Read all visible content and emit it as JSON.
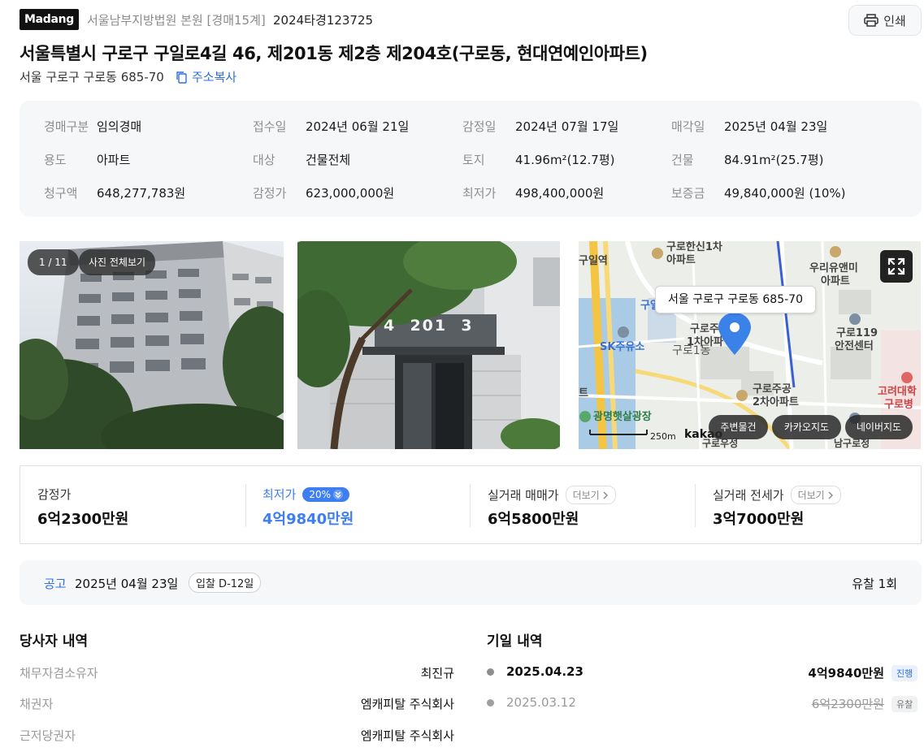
{
  "header": {
    "logo": "Madang",
    "court": "서울남부지방법원 본원 [경매15계]",
    "case_number": "2024타경123725",
    "print_label": "인쇄",
    "title": "서울특별시 구로구 구일로4길 46, 제201동 제2층 제204호(구로동, 현대연예인아파트)",
    "lot_address": "서울 구로구 구로동 685-70",
    "copy_label": "주소복사"
  },
  "info": {
    "rows": [
      [
        {
          "label": "경매구분",
          "value": "임의경매"
        },
        {
          "label": "접수일",
          "value": "2024년 06월 21일"
        },
        {
          "label": "감정일",
          "value": "2024년 07월 17일"
        },
        {
          "label": "매각일",
          "value": "2025년 04월 23일"
        }
      ],
      [
        {
          "label": "용도",
          "value": "아파트"
        },
        {
          "label": "대상",
          "value": "건물전체"
        },
        {
          "label": "토지",
          "value": "41.96m²(12.7평)"
        },
        {
          "label": "건물",
          "value": "84.91m²(25.7평)"
        }
      ],
      [
        {
          "label": "청구액",
          "value": "648,277,783원"
        },
        {
          "label": "감정가",
          "value": "623,000,000원"
        },
        {
          "label": "최저가",
          "value": "498,400,000원"
        },
        {
          "label": "보증금",
          "value": "49,840,000원 (10%)"
        }
      ]
    ]
  },
  "photos": {
    "counter": "1 / 11",
    "view_all": "사진 전체보기",
    "building_number_text": "4  201  3"
  },
  "map": {
    "tooltip": "서울 구로구 구로동 685-70",
    "labels": {
      "guro_hanshin_1": "구로한신1차",
      "apart1": "아파트",
      "guil_station": "구일역",
      "uri_1": "우리유앤미",
      "apart2": "아파트",
      "gu_short": "구일",
      "guro_ju_1": "구로주",
      "cha_1": "1차아파",
      "guro_1dong": "구로1동",
      "sk": "SK주유소",
      "safety_1": "구로119",
      "safety_2": "안전센터",
      "guro_jugong_1": "구로주공",
      "guro_jugong_2": "2차아파트",
      "korea_univ_1": "고려대학",
      "korea_univ_2": "구로병",
      "right_label_t": "트",
      "gwangmyeong": "광명햇살광장",
      "scale": "250m",
      "kakao": "kakao",
      "bottom_a": "구로우성",
      "bottom_b": "남구로정"
    },
    "buttons": {
      "nearby": "주변물건",
      "kakao": "카카오지도",
      "naver": "네이버지도"
    }
  },
  "prices": {
    "appraisal": {
      "label": "감정가",
      "value": "6억2300만원"
    },
    "minimum": {
      "label": "최저가",
      "percent": "20%",
      "value": "4억9840만원"
    },
    "trade": {
      "label": "실거래 매매가",
      "more": "더보기",
      "value": "6억5800만원"
    },
    "jeonse": {
      "label": "실거래 전세가",
      "more": "더보기",
      "value": "3억7000만원"
    }
  },
  "notice": {
    "label": "공고",
    "date": "2025년 04월 23일",
    "dday": "입찰 D-12일",
    "fail_count": "유찰 1회"
  },
  "parties": {
    "title": "당사자 내역",
    "items": [
      {
        "label": "채무자겸소유자",
        "value": "최진규"
      },
      {
        "label": "채권자",
        "value": "엠캐피탈 주식회사"
      },
      {
        "label": "근저당권자",
        "value": "엠캐피탈 주식회사"
      }
    ]
  },
  "history": {
    "title": "기일 내역",
    "items": [
      {
        "date": "2025.04.23",
        "price": "4억9840만원",
        "status": "진행"
      },
      {
        "date": "2025.03.12",
        "price": "6억2300만원",
        "status": "유찰"
      }
    ]
  },
  "colors": {
    "accent_blue": "#2f6fe0",
    "min_price_blue": "#3d7ff0"
  }
}
